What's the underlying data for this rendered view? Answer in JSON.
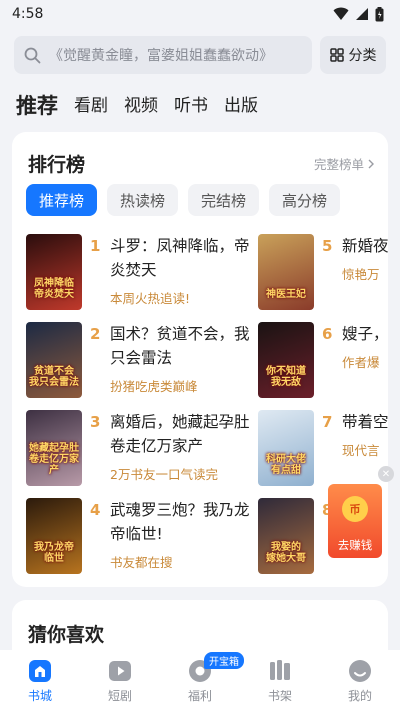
{
  "status_bar": {
    "time": "4:58"
  },
  "search": {
    "placeholder": "《觉醒黄金瞳，富婆姐姐蠢蠢欲动》",
    "category_label": "分类"
  },
  "top_tabs": [
    {
      "label": "推荐",
      "active": true
    },
    {
      "label": "看剧"
    },
    {
      "label": "视频"
    },
    {
      "label": "听书"
    },
    {
      "label": "出版"
    }
  ],
  "ranking": {
    "title": "排行榜",
    "more_label": "完整榜单",
    "sub_tabs": [
      {
        "label": "推荐榜",
        "active": true
      },
      {
        "label": "热读榜"
      },
      {
        "label": "完结榜"
      },
      {
        "label": "高分榜"
      }
    ],
    "books": [
      {
        "rank": "1",
        "title": "斗罗：凤神降临，帝炎焚天",
        "desc": "本周火热追读!",
        "cover_text": "凤神降临\n帝炎焚天",
        "cover_colors": [
          "#2a0d0d",
          "#c0392b"
        ]
      },
      {
        "rank": "2",
        "title": "国术？贫道不会，我只会雷法",
        "desc": "扮猪吃虎类巅峰",
        "cover_text": "贫道不会\n我只会雷法",
        "cover_colors": [
          "#1c2a44",
          "#8e5a3c"
        ]
      },
      {
        "rank": "3",
        "title": "离婚后，她藏起孕肚卷走亿万家产",
        "desc": "2万书友一口气读完",
        "cover_text": "她藏起孕肚\n卷走亿万家产",
        "cover_colors": [
          "#3d3042",
          "#b89aa8"
        ]
      },
      {
        "rank": "4",
        "title": "武魂罗三炮？我乃龙帝临世!",
        "desc": "书友都在搜",
        "cover_text": "我乃龙帝\n临世",
        "cover_colors": [
          "#2b1a0c",
          "#b8741f"
        ]
      },
      {
        "rank": "5",
        "title": "新婚夜爆医妃",
        "desc": "惊艳万",
        "cover_text": "神医王妃",
        "cover_colors": [
          "#c9a15a",
          "#8a3b2a"
        ]
      },
      {
        "rank": "6",
        "title": "嫂子，无敌?",
        "desc": "作者爆",
        "cover_text": "你不知道\n我无敌",
        "cover_colors": [
          "#1a1313",
          "#6b1f2a"
        ]
      },
      {
        "rank": "7",
        "title": "带着空科研大",
        "desc": "现代言",
        "cover_text": "科研大佬\n有点甜",
        "cover_colors": [
          "#dfe9f2",
          "#8fb0cf"
        ]
      },
      {
        "rank": "8",
        "title": "",
        "desc": "",
        "cover_text": "我娶的\n嫁她大哥",
        "cover_colors": [
          "#2f2a3a",
          "#a76b3e"
        ]
      }
    ]
  },
  "guess": {
    "title": "猜你喜欢"
  },
  "coin_widget": {
    "label": "去赚钱",
    "coin_symbol": "币"
  },
  "bottom_nav": [
    {
      "label": "书城",
      "icon": "home-icon",
      "active": true
    },
    {
      "label": "短剧",
      "icon": "play-icon"
    },
    {
      "label": "福利",
      "icon": "gift-icon",
      "badge": "开宝箱"
    },
    {
      "label": "书架",
      "icon": "bookshelf-icon"
    },
    {
      "label": "我的",
      "icon": "profile-icon"
    }
  ],
  "colors": {
    "accent": "#1677ff",
    "rank_number": "#e7a048",
    "desc": "#c98a3a"
  }
}
